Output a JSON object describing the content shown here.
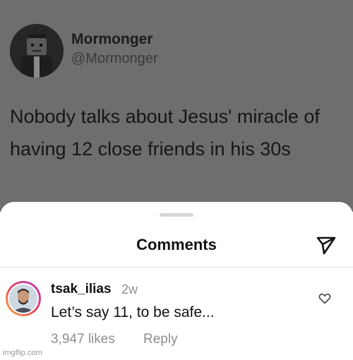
{
  "tweet": {
    "name": "Mormonger",
    "handle": "@Mormonger",
    "text_line1": "Nobody talks about Jesus' miracle of",
    "text_line2": "having 12 close friends in his 30s"
  },
  "comments_sheet": {
    "title": "Comments",
    "send_icon": "send-icon"
  },
  "comment": {
    "username": "tsak_ilias",
    "time": "2w",
    "text": "Let’s say 11, to be safe...",
    "likes": "3,947 likes",
    "reply": "Reply",
    "heart_icon": "heart-icon"
  },
  "watermark": "imgflip.com",
  "colors": {
    "tweet_overlay": "#6e6e6e",
    "sheet_bg": "#ffffff",
    "muted_text": "#8e8e8e",
    "story_ring_start": "#f5b437",
    "story_ring_end": "#b43cb8"
  }
}
